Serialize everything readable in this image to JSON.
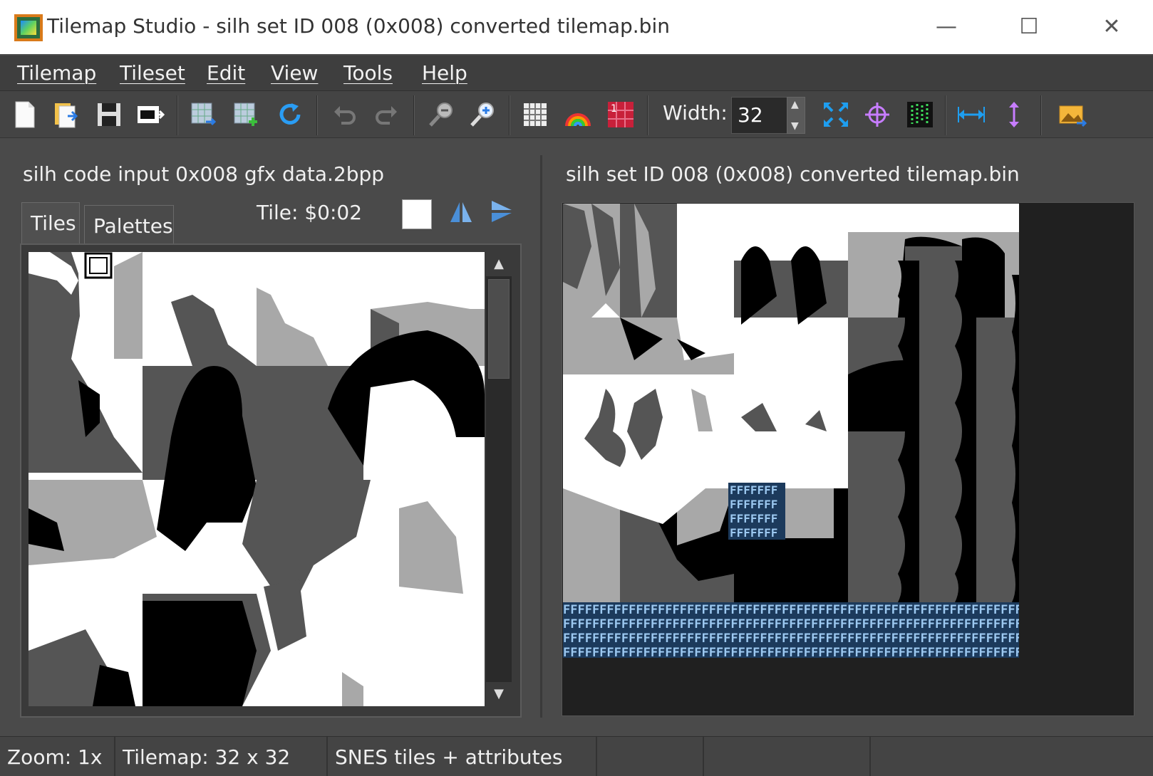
{
  "window": {
    "title": "Tilemap Studio - silh set ID 008 (0x008) converted tilemap.bin",
    "minimize": "—",
    "maximize": "☐",
    "close": "✕"
  },
  "menu": [
    "Tilemap",
    "Tileset",
    "Edit",
    "View",
    "Tools",
    "Help"
  ],
  "toolbar": {
    "width_label": "Width:",
    "width_value": "32",
    "icons": [
      "new-file-icon",
      "open-file-icon",
      "save-icon",
      "export-icon",
      "load-tileset-icon",
      "add-tileset-icon",
      "reload-icon",
      "undo-icon",
      "redo-icon",
      "zoom-out-icon",
      "zoom-in-icon",
      "grid-icon",
      "palette-rainbow-icon",
      "priority-icon",
      "resize-icon",
      "move-icon",
      "image-to-tiles-icon",
      "width-arrow-icon",
      "height-arrow-icon",
      "image-export-icon"
    ]
  },
  "tileset": {
    "title": "silh code input 0x008 gfx data.2bpp",
    "tabs": [
      "Tiles",
      "Palettes"
    ],
    "tile_label": "Tile: $0:02"
  },
  "tilemap": {
    "title": "silh set ID 008 (0x008) converted tilemap.bin",
    "fill_char": "FFFFFFFF"
  },
  "status": {
    "zoom": "Zoom: 1x",
    "tilemap_size": "Tilemap: 32 x 32",
    "format": "SNES tiles + attributes",
    "cell4": "",
    "cell5": "",
    "cell6": ""
  },
  "colors": {
    "bg": "#4a4a4a",
    "light_gray": "#a8a8a8",
    "dark_gray": "#555555",
    "black": "#000000",
    "white": "#ffffff",
    "placeholder_tile": "#1c3a5c"
  }
}
